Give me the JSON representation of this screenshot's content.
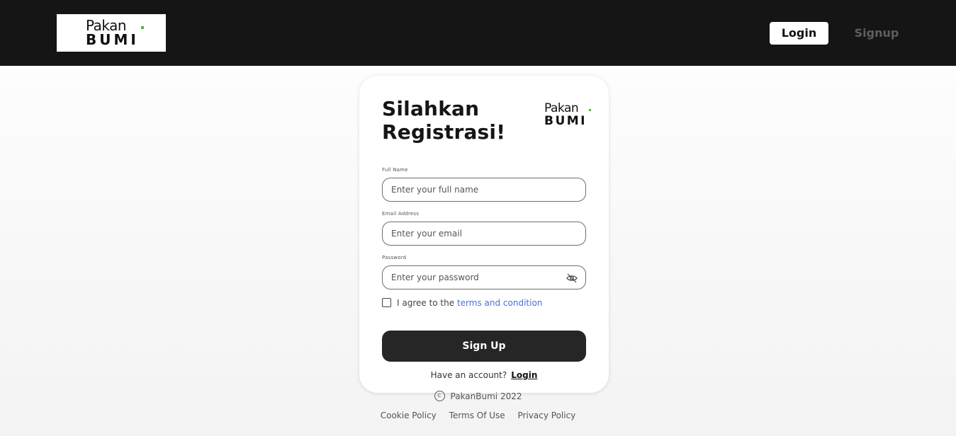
{
  "header": {
    "logo": {
      "line1": "Pakan",
      "line2": "BUMI"
    },
    "nav": {
      "login": "Login",
      "signup": "Signup"
    }
  },
  "card": {
    "title_line1": "Silahkan",
    "title_line2": "Registrasi!",
    "logo": {
      "line1": "Pakan",
      "line2": "BUMI"
    },
    "fields": {
      "full_name": {
        "label": "Full Name",
        "placeholder": "Enter your full name",
        "value": ""
      },
      "email": {
        "label": "Email Address",
        "placeholder": "Enter your email",
        "value": ""
      },
      "password": {
        "label": "Password",
        "placeholder": "Enter your password",
        "value": ""
      }
    },
    "agree": {
      "prefix": "I agree to the ",
      "link": "terms and condition",
      "checked": false
    },
    "submit": "Sign Up",
    "have_account": {
      "text": "Have an account?",
      "link": "Login"
    }
  },
  "footer": {
    "copyright_symbol": "c",
    "copyright": "PakanBumi 2022",
    "links": [
      "Cookie Policy",
      "Terms Of Use",
      "Privacy Policy"
    ]
  },
  "colors": {
    "header_bg": "#151515",
    "accent_green": "#59b53d",
    "link_blue": "#4a6fd8",
    "button_dark": "#262626"
  }
}
